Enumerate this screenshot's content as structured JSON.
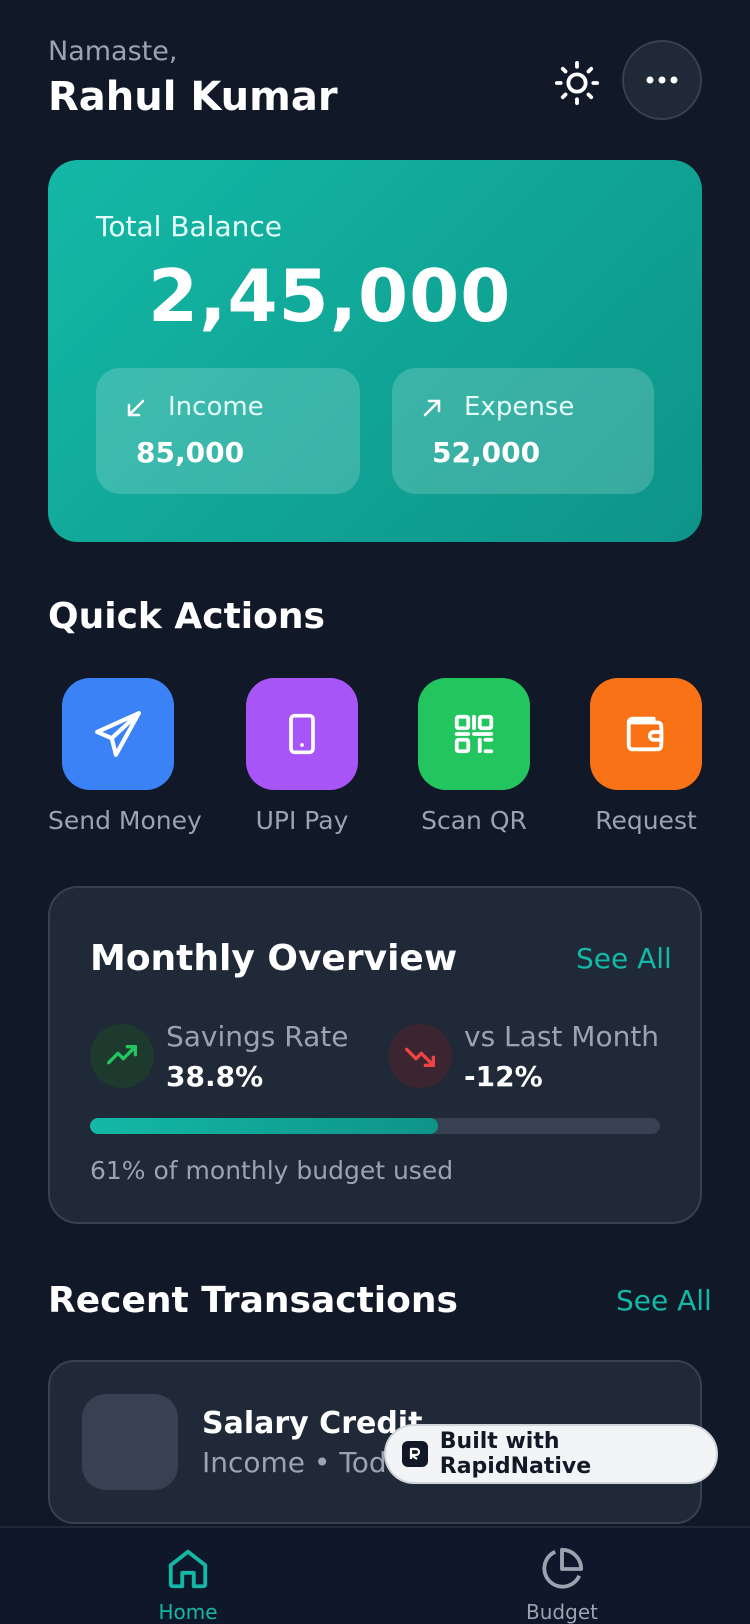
{
  "header": {
    "greeting": "Namaste,",
    "user_name": "Rahul Kumar"
  },
  "balance": {
    "label": "Total Balance",
    "value": "2,45,000",
    "income": {
      "label": "Income",
      "value": "85,000"
    },
    "expense": {
      "label": "Expense",
      "value": "52,000"
    }
  },
  "quick_actions": {
    "title": "Quick Actions",
    "items": [
      {
        "label": "Send Money",
        "icon": "send-icon",
        "color": "#3b82f6"
      },
      {
        "label": "UPI Pay",
        "icon": "smartphone-icon",
        "color": "#a855f7"
      },
      {
        "label": "Scan QR",
        "icon": "qr-code-icon",
        "color": "#22c55e"
      },
      {
        "label": "Request",
        "icon": "wallet-icon",
        "color": "#f97316"
      }
    ]
  },
  "overview": {
    "title": "Monthly Overview",
    "see_all": "See All",
    "savings_label": "Savings Rate",
    "savings_value": "38.8%",
    "vs_label": "vs Last Month",
    "vs_value": "-12%",
    "budget_used_fraction": 0.61,
    "budget_note": "61% of monthly budget used"
  },
  "recent": {
    "title": "Recent Transactions",
    "see_all": "See All",
    "transactions": [
      {
        "title": "Salary Credit",
        "subtitle": "Income • Today"
      }
    ]
  },
  "badge": {
    "text": "Built with RapidNative"
  },
  "nav": {
    "home": "Home",
    "budget": "Budget"
  },
  "colors": {
    "accent": "#14b8a6",
    "background": "#111827",
    "card": "#1f2937",
    "positive": "#22c55e",
    "negative": "#ef4444"
  }
}
